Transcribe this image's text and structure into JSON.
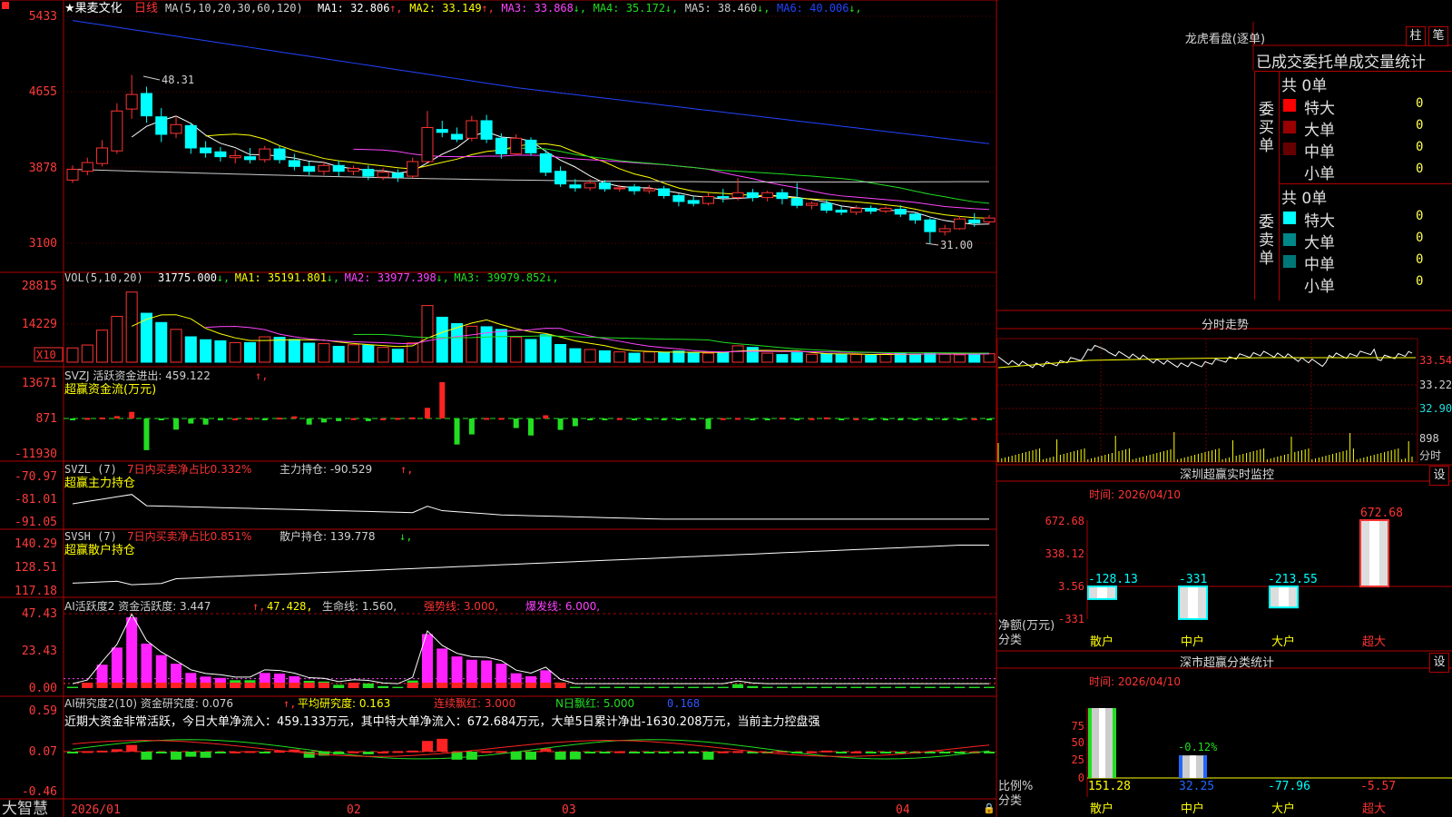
{
  "app": {
    "brand": "大智慧",
    "stock_name": "★果麦文化",
    "period": "日线"
  },
  "main_panel": {
    "ma_header": "MA(5,10,20,30,60,120)",
    "ma_values": [
      {
        "label": "MA1: 32.806",
        "arrow": "↑",
        "color": "#ffffff"
      },
      {
        "label": "MA2: 33.149",
        "arrow": "↑",
        "color": "#ffff00"
      },
      {
        "label": "MA3: 33.868",
        "arrow": "↓",
        "color": "#ff44ff"
      },
      {
        "label": "MA4: 35.172",
        "arrow": "↓",
        "color": "#22dd22"
      },
      {
        "label": "MA5: 38.460",
        "arrow": "↓",
        "color": "#cccccc"
      },
      {
        "label": "MA6: 40.006",
        "arrow": "↓",
        "color": "#2244ff"
      }
    ],
    "y_ticks": [
      "5433",
      "4655",
      "3878",
      "3100"
    ],
    "high_label": "48.31",
    "low_label": "31.00"
  },
  "vol_panel": {
    "header": "VOL(5,10,20)",
    "values": [
      {
        "label": "31775.000",
        "arrow": "↓",
        "color": "#ffffff"
      },
      {
        "label": "MA1: 35191.801",
        "arrow": "↓",
        "color": "#ffff00"
      },
      {
        "label": "MA2: 33977.398",
        "arrow": "↓",
        "color": "#ff44ff"
      },
      {
        "label": "MA3: 39979.852",
        "arrow": "↓",
        "color": "#22dd22"
      }
    ],
    "y_ticks": [
      "28815",
      "14229"
    ],
    "unit": "X10"
  },
  "svzj_panel": {
    "header": "SVZJ  活跃资金进出: 459.122",
    "subtitle": "超赢资金流(万元)",
    "y_ticks": [
      "13671",
      "871",
      "-11930"
    ]
  },
  "svzl_panel": {
    "header_name": "SVZL (7)",
    "header_red": "7日内买卖净占比0.332%",
    "header_white": "主力持仓: -90.529",
    "subtitle": "超赢主力持仓",
    "y_ticks": [
      "-70.97",
      "-81.01",
      "-91.05"
    ]
  },
  "svsh_panel": {
    "header_name": "SVSH (7)",
    "header_red": "7日内买卖净占比0.851%",
    "header_white": "散户持仓: 139.778",
    "subtitle": "超赢散户持仓",
    "y_ticks": [
      "140.29",
      "128.51",
      "117.18"
    ]
  },
  "ai_active_panel": {
    "header": "AI活跃度2 资金活跃度: 3.447",
    "v2": "47.428,",
    "v3": "生命线: 1.560,",
    "v4": "强势线: 3.000,",
    "v5": "爆发线: 6.000,",
    "y_ticks": [
      "47.43",
      "23.43",
      "0.00"
    ]
  },
  "ai_research_panel": {
    "header": "AI研究度2(10) 资金研究度: 0.076",
    "v2": "平均研究度: 0.163",
    "v3": "连续飘红: 3.000",
    "v4": "N日飘红: 5.000",
    "v5": "0.168",
    "comment": "近期大资金非常活跃，今日大单净流入：459.133万元，其中特大单净流入：672.684万元，大单5日累计净出-1630.208万元，当前主力控盘强",
    "y_ticks": [
      "0.59",
      "0.07",
      "-0.46"
    ]
  },
  "x_axis": [
    "2026/01",
    "02",
    "03",
    "04"
  ],
  "dragon_tiger": {
    "title": "龙虎看盘(逐单)",
    "btn_bar": "柱",
    "btn_pen": "笔",
    "stats_title": "已成交委托单成交量统计",
    "buy_label": "委买单",
    "sell_label": "委卖单",
    "buy_total": "共 0单",
    "sell_total": "共 0单",
    "buy_rows": [
      {
        "label": "特大",
        "count": "0",
        "pct": "0%",
        "color": "#ff0000"
      },
      {
        "label": "大单",
        "count": "0",
        "pct": "0%",
        "color": "#990000"
      },
      {
        "label": "中单",
        "count": "0",
        "pct": "0%",
        "color": "#660000"
      },
      {
        "label": "小单",
        "count": "0",
        "pct": "0%",
        "color": "#000000"
      }
    ],
    "sell_rows": [
      {
        "label": "特大",
        "count": "0",
        "pct": "0%",
        "color": "#00ffff"
      },
      {
        "label": "大单",
        "count": "0",
        "pct": "0%",
        "color": "#008888"
      },
      {
        "label": "中单",
        "count": "0",
        "pct": "0%",
        "color": "#007777"
      },
      {
        "label": "小单",
        "count": "0",
        "pct": "0%",
        "color": "#000000"
      }
    ]
  },
  "intraday": {
    "title": "分时走势",
    "price_ticks": [
      "33.54",
      "33.22",
      "32.90"
    ],
    "vol_tick": "898",
    "vol_unit": "分时"
  },
  "sz_monitor": {
    "title": "深圳超赢实时监控",
    "btn": "设",
    "time": "时间: 2026/04/10",
    "y_ticks": [
      "672.68",
      "338.12",
      "3.56",
      "-331"
    ],
    "unit_label": "净额(万元)",
    "cat_label": "分类",
    "categories": [
      "散户",
      "中户",
      "大户",
      "超大"
    ],
    "values": [
      "-128.13",
      "-331",
      "-213.55",
      "672.68"
    ],
    "value_colors": [
      "#00ffff",
      "#00ffff",
      "#00ffff",
      "#ff3333"
    ]
  },
  "sz_classify": {
    "title": "深市超赢分类统计",
    "btn": "设",
    "time": "时间: 2026/04/10",
    "y_ticks": [
      "75",
      "50",
      "25",
      "0"
    ],
    "unit_label": "比例%",
    "cat_label": "分类",
    "categories": [
      "散户",
      "中户",
      "大户",
      "超大"
    ],
    "values": [
      "151.28",
      "32.25",
      "-77.96",
      "-5.57"
    ],
    "value_colors": [
      "#ffff00",
      "#2266ff",
      "#00ffff",
      "#ff3333"
    ],
    "annot": "-0.12%"
  },
  "chart_data": {
    "type": "candlestick",
    "dates_range": [
      "2026/01",
      "04"
    ],
    "candles": [
      {
        "o": 37.5,
        "c": 38.6,
        "h": 39.0,
        "l": 37.2
      },
      {
        "o": 38.4,
        "c": 39.3,
        "h": 39.8,
        "l": 38.0
      },
      {
        "o": 39.2,
        "c": 40.8,
        "h": 41.6,
        "l": 38.9
      },
      {
        "o": 40.5,
        "c": 44.6,
        "h": 45.4,
        "l": 40.2
      },
      {
        "o": 44.8,
        "c": 46.3,
        "h": 48.31,
        "l": 43.8
      },
      {
        "o": 46.4,
        "c": 44.1,
        "h": 47.1,
        "l": 43.4
      },
      {
        "o": 44.0,
        "c": 42.2,
        "h": 44.9,
        "l": 41.4
      },
      {
        "o": 42.3,
        "c": 43.2,
        "h": 44.1,
        "l": 41.8
      },
      {
        "o": 43.1,
        "c": 40.8,
        "h": 43.4,
        "l": 40.2
      },
      {
        "o": 40.8,
        "c": 40.3,
        "h": 41.5,
        "l": 39.8
      },
      {
        "o": 40.4,
        "c": 39.9,
        "h": 40.9,
        "l": 39.4
      },
      {
        "o": 39.8,
        "c": 40.0,
        "h": 40.6,
        "l": 39.2
      },
      {
        "o": 39.9,
        "c": 39.6,
        "h": 40.8,
        "l": 39.2
      },
      {
        "o": 39.6,
        "c": 40.7,
        "h": 41.0,
        "l": 39.3
      },
      {
        "o": 40.7,
        "c": 39.6,
        "h": 41.0,
        "l": 39.2
      },
      {
        "o": 39.5,
        "c": 38.9,
        "h": 40.2,
        "l": 38.5
      },
      {
        "o": 38.9,
        "c": 38.4,
        "h": 39.4,
        "l": 38.0
      },
      {
        "o": 38.4,
        "c": 39.0,
        "h": 39.4,
        "l": 38.0
      },
      {
        "o": 39.0,
        "c": 38.4,
        "h": 39.5,
        "l": 37.9
      },
      {
        "o": 38.4,
        "c": 38.7,
        "h": 39.0,
        "l": 38.0
      },
      {
        "o": 38.6,
        "c": 37.9,
        "h": 39.0,
        "l": 37.5
      },
      {
        "o": 37.8,
        "c": 38.3,
        "h": 38.7,
        "l": 37.5
      },
      {
        "o": 38.2,
        "c": 37.8,
        "h": 38.6,
        "l": 37.3
      },
      {
        "o": 37.9,
        "c": 39.4,
        "h": 39.8,
        "l": 37.7
      },
      {
        "o": 39.4,
        "c": 42.9,
        "h": 44.6,
        "l": 39.3
      },
      {
        "o": 42.7,
        "c": 42.4,
        "h": 43.6,
        "l": 41.9
      },
      {
        "o": 42.2,
        "c": 41.7,
        "h": 42.9,
        "l": 41.4
      },
      {
        "o": 41.8,
        "c": 43.6,
        "h": 44.1,
        "l": 41.5
      },
      {
        "o": 43.6,
        "c": 41.7,
        "h": 44.2,
        "l": 41.3
      },
      {
        "o": 41.8,
        "c": 40.2,
        "h": 42.3,
        "l": 39.7
      },
      {
        "o": 40.2,
        "c": 41.8,
        "h": 42.2,
        "l": 40.0
      },
      {
        "o": 41.6,
        "c": 40.3,
        "h": 41.9,
        "l": 40.0
      },
      {
        "o": 40.2,
        "c": 38.3,
        "h": 40.6,
        "l": 37.9
      },
      {
        "o": 38.4,
        "c": 37.1,
        "h": 38.9,
        "l": 36.8
      },
      {
        "o": 37.0,
        "c": 36.7,
        "h": 37.6,
        "l": 36.3
      },
      {
        "o": 36.7,
        "c": 37.2,
        "h": 37.6,
        "l": 36.4
      },
      {
        "o": 37.2,
        "c": 36.6,
        "h": 37.5,
        "l": 36.3
      },
      {
        "o": 36.6,
        "c": 36.7,
        "h": 37.0,
        "l": 36.3
      },
      {
        "o": 36.8,
        "c": 36.4,
        "h": 37.1,
        "l": 36.0
      },
      {
        "o": 36.4,
        "c": 36.6,
        "h": 37.0,
        "l": 36.1
      },
      {
        "o": 36.6,
        "c": 35.9,
        "h": 36.9,
        "l": 35.6
      },
      {
        "o": 35.9,
        "c": 35.3,
        "h": 36.1,
        "l": 34.8
      },
      {
        "o": 35.4,
        "c": 35.1,
        "h": 35.8,
        "l": 34.8
      },
      {
        "o": 35.1,
        "c": 35.8,
        "h": 36.2,
        "l": 34.9
      },
      {
        "o": 35.8,
        "c": 35.7,
        "h": 36.6,
        "l": 35.2
      },
      {
        "o": 35.7,
        "c": 36.2,
        "h": 37.7,
        "l": 35.4
      },
      {
        "o": 36.2,
        "c": 35.7,
        "h": 36.6,
        "l": 35.3
      },
      {
        "o": 35.7,
        "c": 36.2,
        "h": 36.4,
        "l": 35.3
      },
      {
        "o": 36.2,
        "c": 35.6,
        "h": 36.6,
        "l": 35.0
      },
      {
        "o": 35.6,
        "c": 34.9,
        "h": 37.2,
        "l": 34.6
      },
      {
        "o": 34.9,
        "c": 35.1,
        "h": 35.3,
        "l": 34.5
      },
      {
        "o": 35.1,
        "c": 34.4,
        "h": 35.5,
        "l": 34.1
      },
      {
        "o": 34.4,
        "c": 34.2,
        "h": 34.8,
        "l": 33.9
      },
      {
        "o": 34.2,
        "c": 34.6,
        "h": 34.9,
        "l": 33.9
      },
      {
        "o": 34.6,
        "c": 34.3,
        "h": 34.9,
        "l": 34.0
      },
      {
        "o": 34.3,
        "c": 34.6,
        "h": 34.8,
        "l": 34.1
      },
      {
        "o": 34.5,
        "c": 34.0,
        "h": 34.9,
        "l": 33.7
      },
      {
        "o": 34.0,
        "c": 33.4,
        "h": 34.2,
        "l": 33.0
      },
      {
        "o": 33.4,
        "c": 32.2,
        "h": 33.6,
        "l": 31.0
      },
      {
        "o": 32.2,
        "c": 32.5,
        "h": 32.9,
        "l": 31.8
      },
      {
        "o": 32.5,
        "c": 33.5,
        "h": 33.8,
        "l": 32.4
      },
      {
        "o": 33.4,
        "c": 33.1,
        "h": 34.1,
        "l": 32.7
      },
      {
        "o": 33.2,
        "c": 33.6,
        "h": 33.9,
        "l": 32.9
      }
    ],
    "volume": [
      5.4,
      6.5,
      12.1,
      17.3,
      26.5,
      18.5,
      15.0,
      12.4,
      9.6,
      8.5,
      8.1,
      7.4,
      7.4,
      9.6,
      9.4,
      8.6,
      7.2,
      7.0,
      6.0,
      6.6,
      6.4,
      5.6,
      4.9,
      7.3,
      21.4,
      17.0,
      14.6,
      13.6,
      13.4,
      12.4,
      9.5,
      8.6,
      10.4,
      6.7,
      5.1,
      4.8,
      4.3,
      3.9,
      3.4,
      3.9,
      3.6,
      4.2,
      3.6,
      3.4,
      3.6,
      6.2,
      5.6,
      3.4,
      2.9,
      3.6,
      3.0,
      3.2,
      2.9,
      2.9,
      2.6,
      2.9,
      3.4,
      3.1,
      3.5,
      3.0,
      2.8,
      3.3,
      3.2
    ],
    "flow": [
      -30,
      200,
      380,
      900,
      2500,
      -11930,
      -200,
      -4200,
      -1900,
      -2300,
      -600,
      30,
      200,
      -220,
      300,
      800,
      -2300,
      -1500,
      -1000,
      100,
      -1000,
      20,
      200,
      400,
      4000,
      13671,
      -9800,
      -6000,
      200,
      200,
      -3600,
      -6400,
      1200,
      -4300,
      -2900,
      -150,
      -200,
      120,
      -500,
      -140,
      -200,
      -100,
      -110,
      -4000,
      100,
      200,
      -50,
      -130,
      300,
      -600,
      100,
      400,
      -80,
      40,
      -100,
      -80,
      -200,
      -70,
      -80,
      -120,
      -90,
      30,
      -60
    ]
  }
}
